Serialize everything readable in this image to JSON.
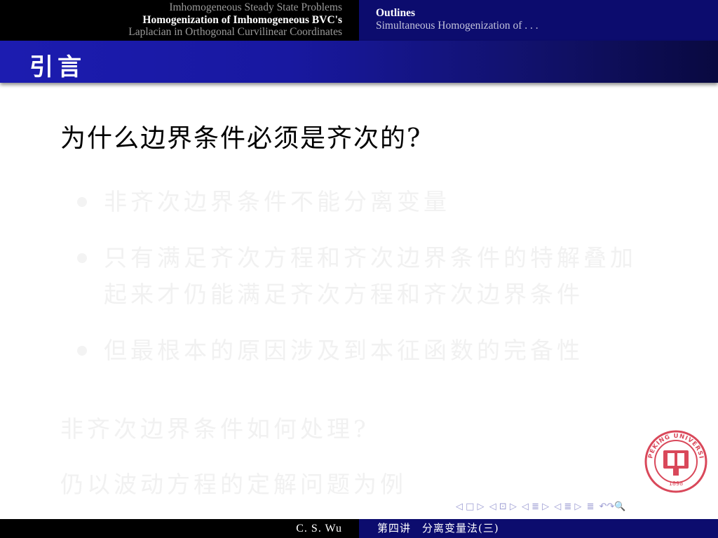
{
  "header": {
    "sections": [
      "Imhomogeneous Steady State Problems",
      "Homogenization of Imhomogeneous BVC's",
      "Laplacian in Orthogonal Curvilinear Coordinates"
    ],
    "subsections": [
      "Outlines",
      "Simultaneous Homogenization of . . ."
    ]
  },
  "frame": {
    "title": "引言"
  },
  "content": {
    "question": "为什么边界条件必须是齐次的?",
    "bullets": [
      "非齐次边界条件不能分离变量",
      "只有满足齐次方程和齐次边界条件的特解叠加起来才仍能满足齐次方程和齐次边界条件",
      "但最根本的原因涉及到本征函数的完备性"
    ],
    "question2": "非齐次边界条件如何处理?",
    "question3": "仍以波动方程的定解问题为例"
  },
  "logo": {
    "year": "1898",
    "name": "PEKING UNIVERSITY"
  },
  "nav": {
    "frame": "◁ □ ▷",
    "subsection": "◁ ⊡ ▷",
    "section_prev": "◁ ≣ ▷",
    "section_next": "◁ ≣ ▷",
    "align": "≣",
    "search": "↶↷🔍"
  },
  "footer": {
    "author": "C. S. Wu",
    "lecture": "第四讲　分离变量法(三)"
  },
  "colors": {
    "header_dark": "#000000",
    "header_blue": "#0c0c6e",
    "title_gradient_start": "#1c1cb0",
    "logo_red": "#d9485a"
  }
}
